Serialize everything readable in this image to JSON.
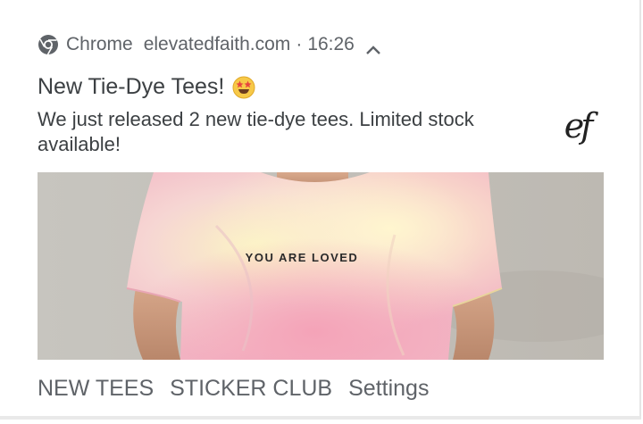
{
  "notification": {
    "app_name": "Chrome",
    "site": "elevatedfaith.com",
    "separator": "·",
    "time": "16:26",
    "title": "New Tie-Dye Tees!",
    "body": "We just released 2 new tie-dye tees. Limited stock available!",
    "logo_text": "ef",
    "image_shirt_text": "YOU ARE LOVED",
    "actions": [
      "NEW TEES",
      "STICKER CLUB",
      "Settings"
    ]
  },
  "icons": {
    "app": "chrome-icon",
    "expand": "chevron-up-icon",
    "emoji": "star-struck-emoji-icon"
  },
  "colors": {
    "secondary_text": "#5f6368",
    "primary_text": "#3c4043"
  }
}
